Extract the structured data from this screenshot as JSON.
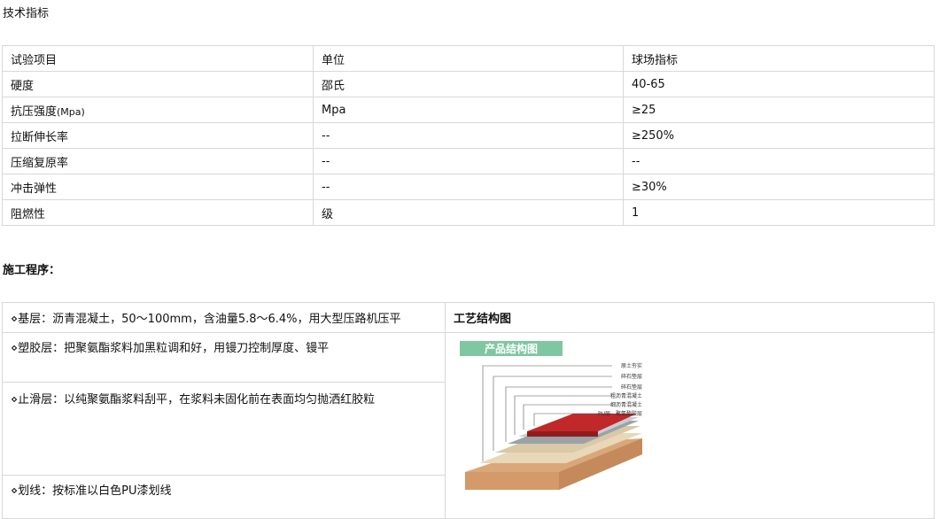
{
  "heading": "技术指标",
  "spec_table": {
    "headers": [
      "试验项目",
      "单位",
      "球场指标"
    ],
    "rows": [
      {
        "item": "硬度",
        "unit": "邵氏",
        "value": "40-65"
      },
      {
        "item": "抗压强度",
        "item_suffix": "(Mpa)",
        "unit": "Mpa",
        "value": "≥25"
      },
      {
        "item": "拉断伸长率",
        "unit": "--",
        "value": "≥250%"
      },
      {
        "item": "压缩复原率",
        "unit": "--",
        "value": "--"
      },
      {
        "item": "冲击弹性",
        "unit": "--",
        "value": "≥30%"
      },
      {
        "item": "阻燃性",
        "unit": "级",
        "value": "1"
      }
    ]
  },
  "section_title": "施工程序：",
  "procedure": {
    "steps": [
      "⋄基层：沥青混凝土，50～100mm，含油量5.8～6.4%，用大型压路机压平",
      "⋄塑胶层：把聚氨酯浆料加黑粒调和好，用镘刀控制厚度、镘平",
      "⋄止滑层：以纯聚氨酯浆料刮平，在浆料未固化前在表面均匀抛洒红胶粒",
      "⋄划线：按标准以白色PU漆划线"
    ],
    "diagram_title": "工艺结构图",
    "diagram": {
      "banner": "产品结构图",
      "layers": [
        "原土夯实",
        "碎石垫层",
        "碎石垫层",
        "粗沥青混凝土",
        "细沥青混凝土",
        "PU层 - 聚氨酯胶层"
      ],
      "colors": {
        "banner_bg": "#7fc7a0",
        "top_layer": "#c0282a",
        "soil": "#d9a77a"
      }
    }
  }
}
